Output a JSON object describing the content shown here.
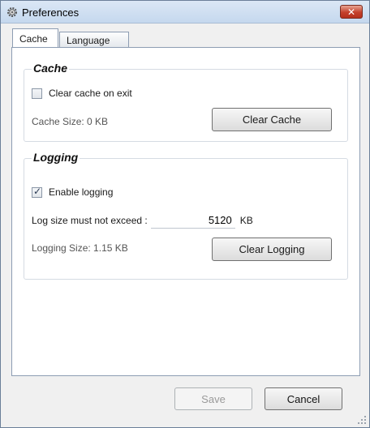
{
  "window": {
    "title": "Preferences",
    "close_label": "✕"
  },
  "tabs": [
    {
      "label": "Cache",
      "active": true
    },
    {
      "label": "Language",
      "active": false
    }
  ],
  "cache": {
    "group_title": "Cache",
    "clear_on_exit_label": "Clear cache on exit",
    "clear_on_exit_checked": false,
    "size_text": "Cache Size: 0 KB",
    "clear_button": "Clear Cache"
  },
  "logging": {
    "group_title": "Logging",
    "enable_label": "Enable logging",
    "enable_checked": true,
    "limit_label": "Log size must not exceed :",
    "limit_value": "5120",
    "limit_unit": "KB",
    "size_text": "Logging Size: 1.15 KB",
    "clear_button": "Clear Logging"
  },
  "footer": {
    "save_label": "Save",
    "cancel_label": "Cancel"
  },
  "colors": {
    "titlebar": "#c5d8ee",
    "close_button": "#c4402b",
    "panel": "#ffffff"
  },
  "icons": [
    "gear-icon",
    "close-icon",
    "resize-grip-icon"
  ]
}
